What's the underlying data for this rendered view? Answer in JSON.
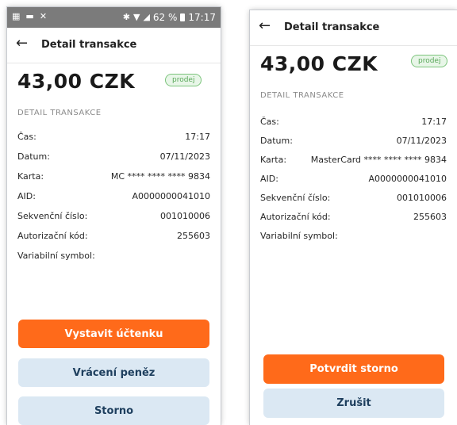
{
  "status_bar": {
    "left_icons": [
      "app-notification-icon",
      "message-icon",
      "x-icon"
    ],
    "battery": "62 %",
    "time": "17:17"
  },
  "screens": [
    {
      "title": "Detail transakce",
      "amount": "43,00 CZK",
      "badge": "prodej",
      "section": "DETAIL TRANSAKCE",
      "rows": [
        {
          "label": "Čas:",
          "value": "17:17"
        },
        {
          "label": "Datum:",
          "value": "07/11/2023"
        },
        {
          "label": "Karta:",
          "value": "MC **** **** **** 9834"
        },
        {
          "label": "AID:",
          "value": "A0000000041010"
        },
        {
          "label": "Sekvenční číslo:",
          "value": "001010006"
        },
        {
          "label": "Autorizační kód:",
          "value": "255603"
        },
        {
          "label": "Variabilní symbol:",
          "value": ""
        }
      ],
      "buttons": [
        "Vystavit účtenku",
        "Vrácení peněz",
        "Storno"
      ]
    },
    {
      "title": "Detail transakce",
      "amount": "43,00 CZK",
      "badge": "prodej",
      "section": "DETAIL TRANSAKCE",
      "rows": [
        {
          "label": "Čas:",
          "value": "17:17"
        },
        {
          "label": "Datum:",
          "value": "07/11/2023"
        },
        {
          "label": "Karta:",
          "value": "MasterCard **** **** **** 9834"
        },
        {
          "label": "AID:",
          "value": "A0000000041010"
        },
        {
          "label": "Sekvenční číslo:",
          "value": "001010006"
        },
        {
          "label": "Autorizační kód:",
          "value": "255603"
        },
        {
          "label": "Variabilní symbol:",
          "value": ""
        }
      ],
      "buttons": [
        "Potvrdit storno",
        "Zrušit"
      ]
    }
  ],
  "colors": {
    "primary": "#ff6a1a",
    "secondary": "#dbe8f3",
    "badge_text": "#5aa85a",
    "status_bar": "#7b7b7b"
  }
}
